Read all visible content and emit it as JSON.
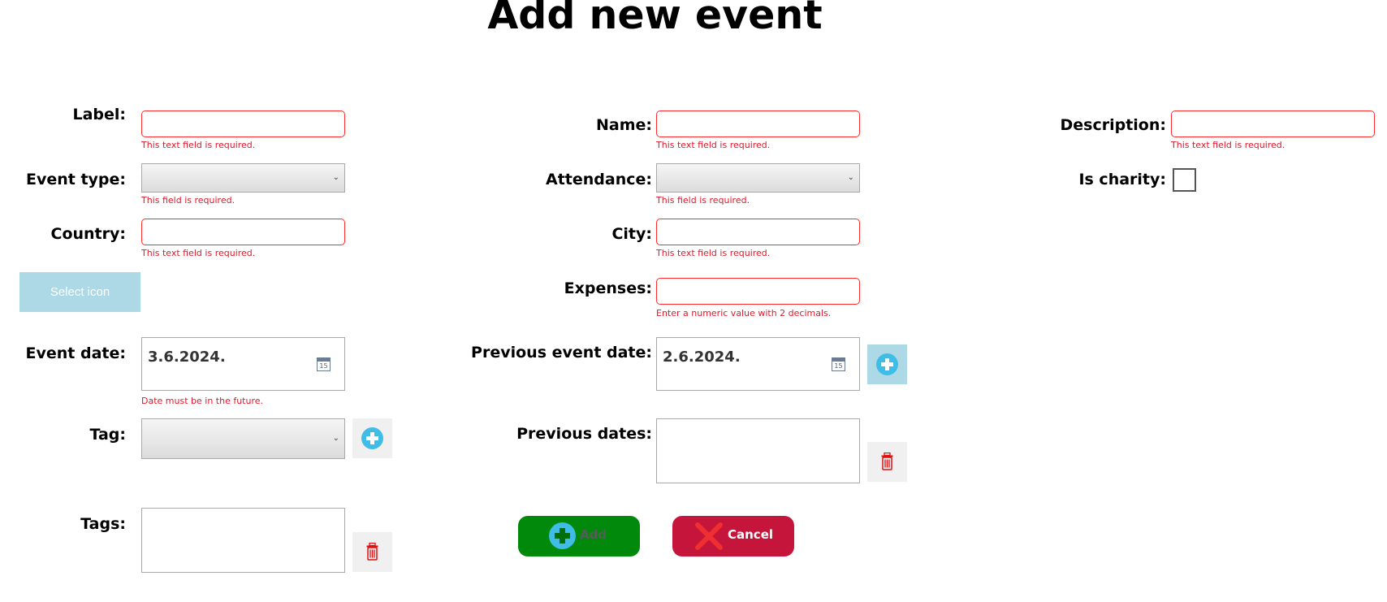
{
  "page": {
    "title": "Add new event"
  },
  "labels": {
    "label": "Label:",
    "name": "Name:",
    "description": "Description:",
    "event_type": "Event type:",
    "attendance": "Attendance:",
    "is_charity": "Is charity:",
    "country": "Country:",
    "city": "City:",
    "expenses": "Expenses:",
    "event_date": "Event date:",
    "previous_event_date": "Previous event date:",
    "tag": "Tag:",
    "previous_dates": "Previous dates:",
    "tags": "Tags:"
  },
  "errors": {
    "label": "This text field is required.",
    "name": "This text field is required.",
    "description": "This text field is required.",
    "event_type": "This field is required.",
    "attendance": "This field is required.",
    "country": "This text field is required.",
    "city": "This text field is required.",
    "expenses": "Enter a numeric value with 2 decimals.",
    "event_date": "Date must be in the future."
  },
  "fields": {
    "label": "",
    "name": "",
    "description": "",
    "event_type": "",
    "attendance": "",
    "country": "",
    "city": "",
    "expenses": "",
    "event_date": "3.6.2024.",
    "previous_event_date": "2.6.2024.",
    "tag": "",
    "is_charity": false
  },
  "calendar_day": "15",
  "buttons": {
    "select_icon": "Select icon",
    "add": "Add",
    "cancel": "Cancel"
  },
  "icons": {
    "dropdown": "chevron-down-icon",
    "calendar": "calendar-icon",
    "add": "plus-circle-icon",
    "delete": "trash-icon",
    "cancel": "close-icon"
  },
  "colors": {
    "error": "#e0182a",
    "add_button": "#00890a",
    "cancel_button": "#c6153b",
    "select_icon_button": "#add8e6",
    "plus_icon": "#3fbde6"
  }
}
